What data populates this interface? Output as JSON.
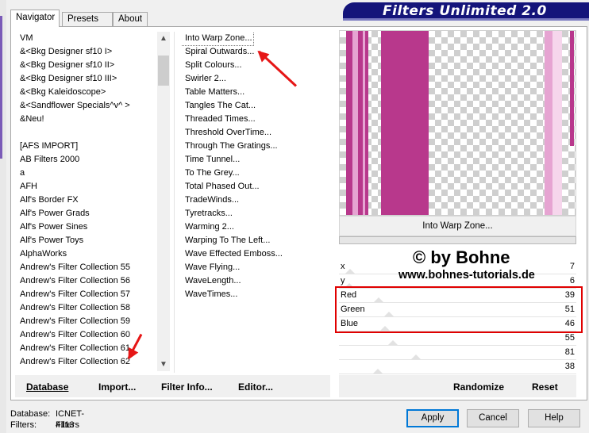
{
  "tabs": [
    {
      "label": "Navigator"
    },
    {
      "label": "Presets"
    },
    {
      "label": "About"
    }
  ],
  "header": {
    "title": "Filters Unlimited 2.0"
  },
  "categories": [
    "VM",
    "&<Bkg Designer sf10 I>",
    "&<Bkg Designer sf10 II>",
    "&<Bkg Designer sf10 III>",
    "&<Bkg Kaleidoscope>",
    "&<Sandflower Specials^v^ >",
    "&Neu!",
    "",
    "[AFS IMPORT]",
    "AB Filters 2000",
    "a",
    "AFH",
    "Alf's Border FX",
    "Alf's Power Grads",
    "Alf's Power Sines",
    "Alf's Power Toys",
    "AlphaWorks",
    "Andrew's Filter Collection 55",
    "Andrew's Filter Collection 56",
    "Andrew's Filter Collection 57",
    "Andrew's Filter Collection 58",
    "Andrew's Filter Collection 59",
    "Andrew's Filter Collection 60",
    "Andrew's Filter Collection 61",
    "Andrew's Filter Collection 62"
  ],
  "filters": [
    "Into Warp Zone...",
    "Spiral Outwards...",
    "Split Colours...",
    "Swirler 2...",
    "Table Matters...",
    "Tangles The Cat...",
    "Threaded Times...",
    "Threshold OverTime...",
    "Through The Gratings...",
    "Time Tunnel...",
    "To The Grey...",
    "Total Phased Out...",
    "TradeWinds...",
    "Tyretracks...",
    "Warming 2...",
    "Warping To The Left...",
    "Wave Effected Emboss...",
    "Wave Flying...",
    "WaveLength...",
    "WaveTimes..."
  ],
  "selected_filter_label": "Into Warp Zone...",
  "sliders": [
    {
      "label": "x",
      "value": "7",
      "level": 7
    },
    {
      "label": "y",
      "value": "6",
      "level": 6
    },
    {
      "label": "Red",
      "value": "39",
      "level": 39
    },
    {
      "label": "Green",
      "value": "51",
      "level": 51
    },
    {
      "label": "Blue",
      "value": "46",
      "level": 46
    },
    {
      "label": "",
      "value": "55",
      "level": 55
    },
    {
      "label": "",
      "value": "81",
      "level": 81
    },
    {
      "label": "",
      "value": "38",
      "level": 38
    }
  ],
  "watermark": {
    "line1": "© by Bohne",
    "line2": "www.bohnes-tutorials.de"
  },
  "bottom_left": {
    "database": "Database",
    "import": "Import...",
    "filter_info": "Filter Info...",
    "editor": "Editor..."
  },
  "bottom_right": {
    "randomize": "Randomize",
    "reset": "Reset"
  },
  "footer": {
    "database_label": "Database:",
    "database_value": "ICNET-Filters",
    "filters_label": "Filters:",
    "filters_value": "4113"
  },
  "buttons": {
    "apply": "Apply",
    "cancel": "Cancel",
    "help": "Help"
  },
  "colors": {
    "header_bg": "#14147a",
    "stripe_magenta": "#b8388c",
    "stripe_light": "#e6a4d2",
    "highlight_red": "#e00000"
  }
}
